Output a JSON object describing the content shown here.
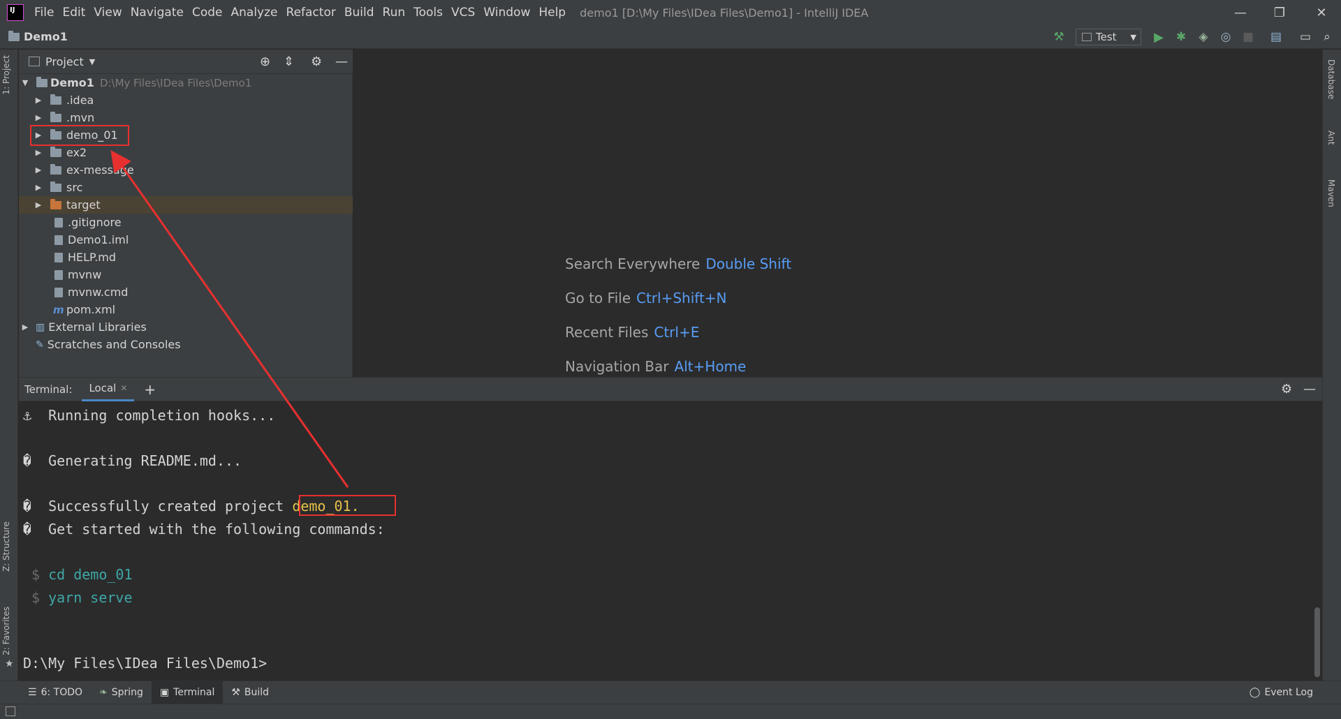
{
  "window": {
    "title": "demo1 [D:\\My Files\\IDea Files\\Demo1] - IntelliJ IDEA",
    "controls": [
      "—",
      "❐",
      "✕"
    ]
  },
  "menu": [
    "File",
    "Edit",
    "View",
    "Navigate",
    "Code",
    "Analyze",
    "Refactor",
    "Build",
    "Run",
    "Tools",
    "VCS",
    "Window",
    "Help"
  ],
  "navbar": {
    "project": "Demo1",
    "run_config": "Test"
  },
  "left_tabs": {
    "project": "1: Project",
    "structure": "Z: Structure",
    "favorites": "2: Favorites"
  },
  "right_tabs": {
    "database": "Database",
    "ant": "Ant",
    "maven": "Maven"
  },
  "project_panel": {
    "title": "Project",
    "root": {
      "name": "Demo1",
      "path": "D:\\My Files\\IDea Files\\Demo1"
    },
    "items": [
      {
        "name": ".idea",
        "kind": "folder"
      },
      {
        "name": ".mvn",
        "kind": "folder"
      },
      {
        "name": "demo_01",
        "kind": "folder"
      },
      {
        "name": "ex2",
        "kind": "folder"
      },
      {
        "name": "ex-message",
        "kind": "folder"
      },
      {
        "name": "src",
        "kind": "folder"
      },
      {
        "name": "target",
        "kind": "folder-excluded"
      },
      {
        "name": ".gitignore",
        "kind": "file"
      },
      {
        "name": "Demo1.iml",
        "kind": "file"
      },
      {
        "name": "HELP.md",
        "kind": "file"
      },
      {
        "name": "mvnw",
        "kind": "file"
      },
      {
        "name": "mvnw.cmd",
        "kind": "file"
      },
      {
        "name": "pom.xml",
        "kind": "maven-file"
      }
    ],
    "external_libraries": "External Libraries",
    "scratches": "Scratches and Consoles"
  },
  "editor_hints": [
    {
      "label": "Search Everywhere",
      "key": "Double Shift"
    },
    {
      "label": "Go to File",
      "key": "Ctrl+Shift+N"
    },
    {
      "label": "Recent Files",
      "key": "Ctrl+E"
    },
    {
      "label": "Navigation Bar",
      "key": "Alt+Home"
    }
  ],
  "terminal": {
    "label": "Terminal:",
    "tab": "Local",
    "lines": {
      "hooks": "⚓  Running completion hooks...",
      "readme": "�  Generating README.md...",
      "created_prefix": "�  Successfully created project ",
      "created_name": "demo_01.",
      "get_started": "�  Get started with the following commands:",
      "cmd1": "cd demo_01",
      "cmd2": "yarn serve",
      "prompt": "D:\\My Files\\IDea Files\\Demo1>"
    },
    "dollar": "$"
  },
  "bottom_tabs": [
    "6: TODO",
    "Spring",
    "Terminal",
    "Build"
  ],
  "event_log": "Event Log",
  "colors": {
    "annotation": "#e83030",
    "accent": "#589df6",
    "cmd": "#3fa7a7"
  }
}
